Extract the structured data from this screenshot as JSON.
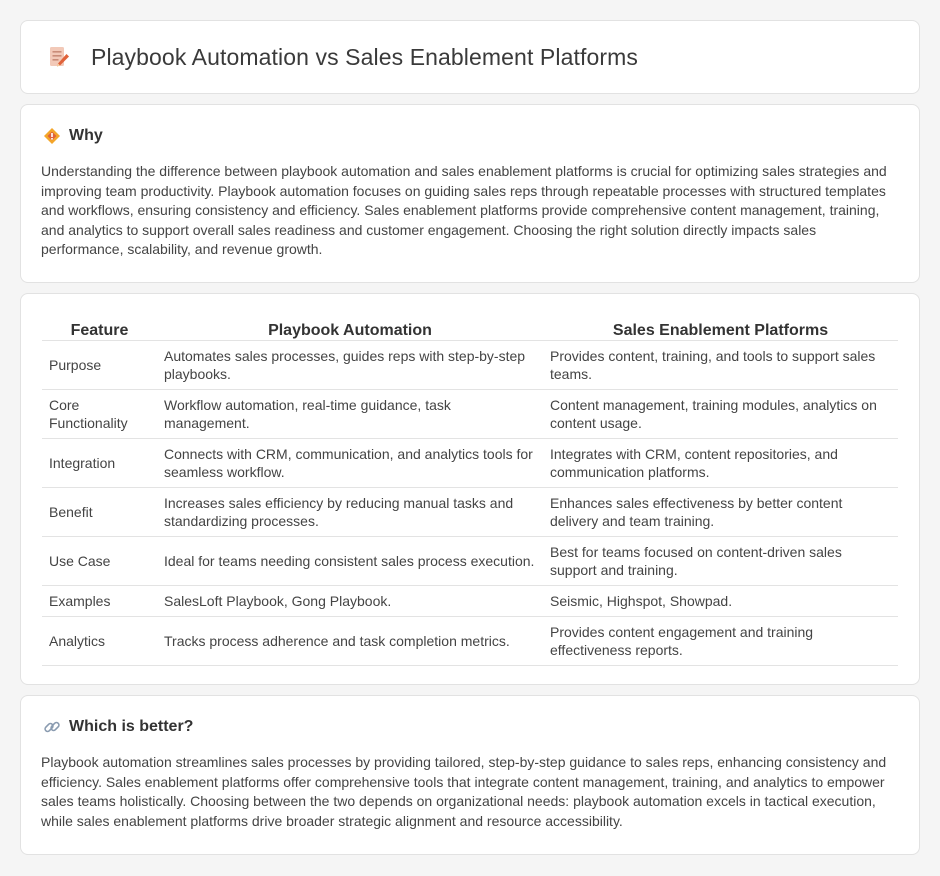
{
  "header": {
    "title": "Playbook Automation vs Sales Enablement Platforms",
    "icon": "document-pencil-icon"
  },
  "why": {
    "icon": "diamond-icon",
    "title": "Why",
    "body": "Understanding the difference between playbook automation and sales enablement platforms is crucial for optimizing sales strategies and improving team productivity. Playbook automation focuses on guiding sales reps through repeatable processes with structured templates and workflows, ensuring consistency and efficiency. Sales enablement platforms provide comprehensive content management, training, and analytics to support overall sales readiness and customer engagement. Choosing the right solution directly impacts sales performance, scalability, and revenue growth."
  },
  "table": {
    "headers": [
      "Feature",
      "Playbook Automation",
      "Sales Enablement Platforms"
    ],
    "rows": [
      [
        "Purpose",
        "Automates sales processes, guides reps with step-by-step playbooks.",
        "Provides content, training, and tools to support sales teams."
      ],
      [
        "Core Functionality",
        "Workflow automation, real-time guidance, task management.",
        "Content management, training modules, analytics on content usage."
      ],
      [
        "Integration",
        "Connects with CRM, communication, and analytics tools for seamless workflow.",
        "Integrates with CRM, content repositories, and communication platforms."
      ],
      [
        "Benefit",
        "Increases sales efficiency by reducing manual tasks and standardizing processes.",
        "Enhances sales effectiveness by better content delivery and team training."
      ],
      [
        "Use Case",
        "Ideal for teams needing consistent sales process execution.",
        "Best for teams focused on content-driven sales support and training."
      ],
      [
        "Examples",
        "SalesLoft Playbook, Gong Playbook.",
        "Seismic, Highspot, Showpad."
      ],
      [
        "Analytics",
        "Tracks process adherence and task completion metrics.",
        "Provides content engagement and training effectiveness reports."
      ]
    ]
  },
  "better": {
    "icon": "link-icon",
    "title": "Which is better?",
    "body": "Playbook automation streamlines sales processes by providing tailored, step-by-step guidance to sales reps, enhancing consistency and efficiency. Sales enablement platforms offer comprehensive tools that integrate content management, training, and analytics to empower sales teams holistically. Choosing between the two depends on organizational needs: playbook automation excels in tactical execution, while sales enablement platforms drive broader strategic alignment and resource accessibility."
  }
}
